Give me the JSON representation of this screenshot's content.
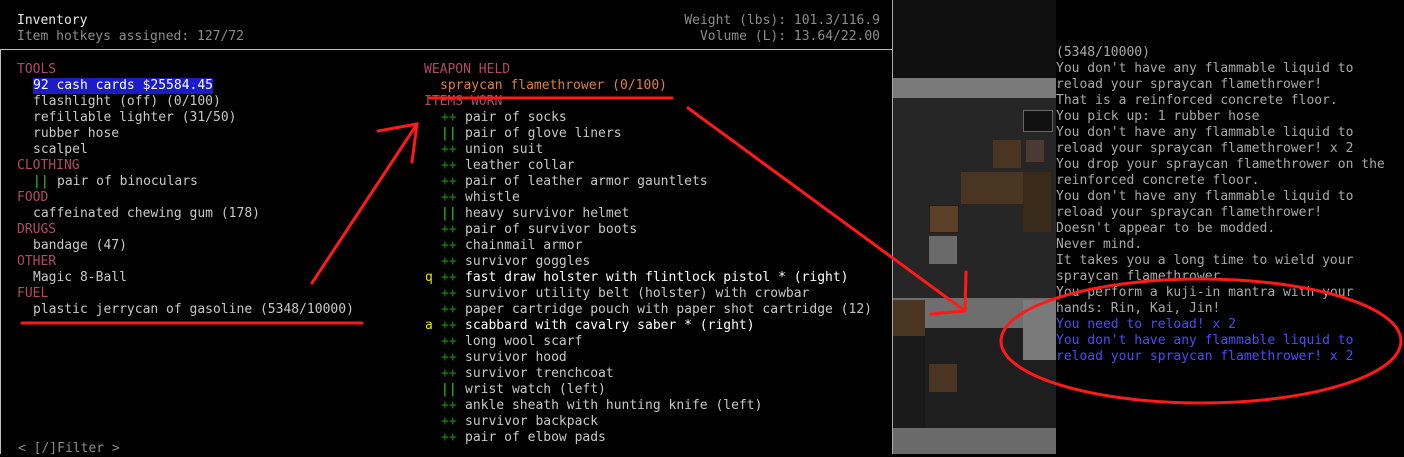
{
  "inventory": {
    "title": "Inventory",
    "hotkeys": "Item hotkeys assigned: 127/72",
    "weight": "Weight (lbs): 101.3/116.9",
    "volume": "Volume (L): 13.64/22.00",
    "filter": "< [/]Filter >"
  },
  "left_column": [
    {
      "type": "cat",
      "text": "TOOLS"
    },
    {
      "type": "item",
      "text": "92 cash cards $25584.45",
      "selected": true
    },
    {
      "type": "item",
      "text": "flashlight (off) (0/100)"
    },
    {
      "type": "item",
      "text": "refillable lighter (31/50)"
    },
    {
      "type": "item",
      "text": "rubber hose"
    },
    {
      "type": "item",
      "text": "scalpel"
    },
    {
      "type": "cat",
      "text": "CLOTHING"
    },
    {
      "type": "item",
      "mark": "||",
      "text": "pair of binoculars"
    },
    {
      "type": "cat",
      "text": "FOOD"
    },
    {
      "type": "item",
      "text": "caffeinated chewing gum (178)"
    },
    {
      "type": "cat",
      "text": "DRUGS"
    },
    {
      "type": "item",
      "text": "bandage (47)"
    },
    {
      "type": "cat",
      "text": "OTHER"
    },
    {
      "type": "item",
      "text": "Magic 8-Ball"
    },
    {
      "type": "cat",
      "text": "FUEL"
    },
    {
      "type": "item",
      "text": "plastic jerrycan of gasoline (5348/10000)"
    }
  ],
  "right_column": {
    "weapon_header": "WEAPON HELD",
    "weapon": "spraycan flamethrower (0/100)",
    "worn_header": "ITEMS WORN",
    "worn": [
      {
        "mark": "++",
        "text": "pair of socks"
      },
      {
        "mark": "||",
        "text": "pair of glove liners"
      },
      {
        "mark": "++",
        "text": "union suit"
      },
      {
        "mark": "++",
        "text": "leather collar"
      },
      {
        "mark": "++",
        "text": "pair of leather armor gauntlets"
      },
      {
        "mark": "++",
        "text": "whistle"
      },
      {
        "mark": "||",
        "text": "heavy survivor helmet"
      },
      {
        "mark": "++",
        "text": "pair of survivor boots"
      },
      {
        "mark": "++",
        "text": "chainmail armor"
      },
      {
        "mark": "++",
        "text": "survivor goggles"
      },
      {
        "key": "q",
        "mark": "++",
        "text": "fast draw holster with flintlock pistol * (right)",
        "bright": true
      },
      {
        "mark": "++",
        "text": "survivor utility belt (holster) with crowbar"
      },
      {
        "mark": "++",
        "text": "paper cartridge pouch with paper shot cartridge (12)"
      },
      {
        "key": "a",
        "mark": "++",
        "text": "scabbard with cavalry saber * (right)",
        "bright": true
      },
      {
        "mark": "++",
        "text": "long wool scarf"
      },
      {
        "mark": "++",
        "text": "survivor hood"
      },
      {
        "mark": "++",
        "text": "survivor trenchcoat"
      },
      {
        "mark": "||",
        "text": "wrist watch (left)"
      },
      {
        "mark": "++",
        "text": "ankle sheath with hunting knife (left)"
      },
      {
        "mark": "++",
        "text": "survivor backpack"
      },
      {
        "mark": "++",
        "text": "pair of elbow pads"
      }
    ]
  },
  "log": [
    {
      "text": "(5348/10000)"
    },
    {
      "text": "You don't have any flammable liquid to"
    },
    {
      "text": "reload your spraycan flamethrower!"
    },
    {
      "text": "That is a reinforced concrete floor."
    },
    {
      "text": "You pick up: 1 rubber hose"
    },
    {
      "text": "You don't have any flammable liquid to"
    },
    {
      "text": "reload your spraycan flamethrower! x 2"
    },
    {
      "text": "You drop your spraycan flamethrower on the"
    },
    {
      "text": "reinforced concrete floor."
    },
    {
      "text": "You don't have any flammable liquid to"
    },
    {
      "text": "reload your spraycan flamethrower!"
    },
    {
      "text": "Doesn't appear to be modded."
    },
    {
      "text": "Never mind."
    },
    {
      "text": "It takes you a long time to wield your"
    },
    {
      "text": "spraycan flamethrower."
    },
    {
      "text": "You perform a kuji-in mantra with your"
    },
    {
      "text": "hands: Rin, Kai, Jin!"
    },
    {
      "text": "You need to reload! x 2",
      "new": true
    },
    {
      "text": "You don't have any flammable liquid to",
      "new": true
    },
    {
      "text": "reload your spraycan flamethrower! x 2",
      "new": true
    }
  ],
  "colors": {
    "category": "#b04a6a",
    "selection": "#1b1bc8",
    "annotation": "#ff1a1a",
    "new_message": "#4a4aff"
  }
}
